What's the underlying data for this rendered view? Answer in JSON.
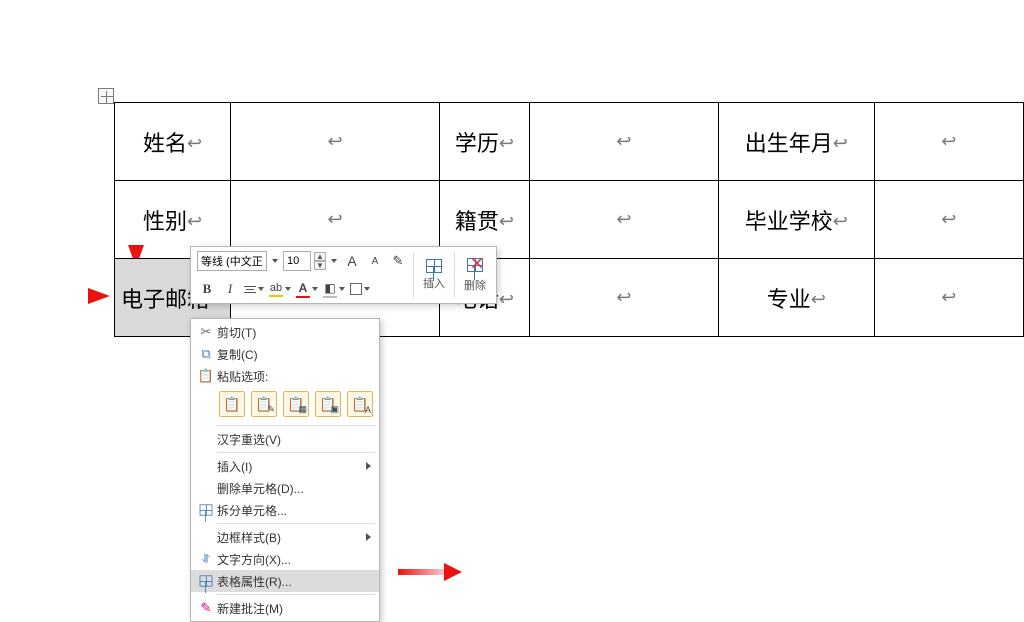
{
  "table": {
    "rows": [
      [
        "姓名",
        "",
        "学历",
        "",
        "出生年月",
        ""
      ],
      [
        "性别",
        "",
        "籍贯",
        "",
        "毕业学校",
        ""
      ],
      [
        "电子邮箱",
        "",
        "电话",
        "",
        "专业",
        ""
      ]
    ]
  },
  "paragraph_mark": "↩",
  "mini_toolbar": {
    "font_name": "等线 (中文正)",
    "font_size": "10",
    "grow_font": "A",
    "shrink_font": "A",
    "b": "B",
    "i": "I",
    "insert_label": "插入",
    "delete_label": "删除"
  },
  "context_menu": {
    "cut": "剪切(T)",
    "copy": "复制(C)",
    "paste_label": "粘贴选项:",
    "ime": "汉字重选(V)",
    "insert": "插入(I)",
    "delete_cells": "删除单元格(D)...",
    "split_cells": "拆分单元格...",
    "border_style": "边框样式(B)",
    "text_dir": "文字方向(X)...",
    "table_props": "表格属性(R)...",
    "new_comment": "新建批注(M)"
  }
}
